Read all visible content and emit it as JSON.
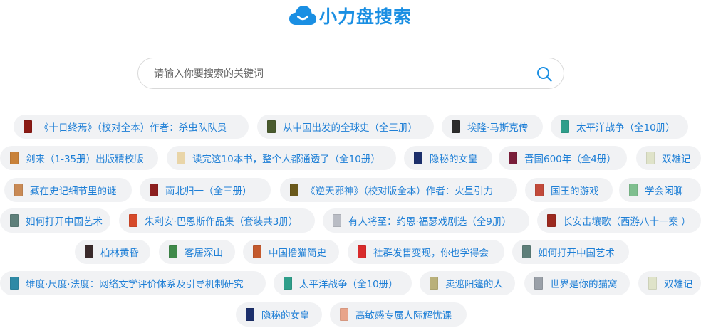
{
  "app": {
    "title": "小力盘搜索",
    "logo_icon": "cloud-icon",
    "accent": "#1a8fe3"
  },
  "search": {
    "placeholder": "请输入你要搜索的关键词",
    "value": "",
    "button_icon": "search-icon"
  },
  "hot_tags": [
    {
      "label": "《十日终焉》（校对全本）作者：杀虫队队员",
      "cover": "#8a1a14"
    },
    {
      "label": "从中国出发的全球史（全三册）",
      "cover": "#4a5b2e"
    },
    {
      "label": "埃隆·马斯克传",
      "cover": "#2c2c2c"
    },
    {
      "label": "太平洋战争（全10册）",
      "cover": "#2f9e8a"
    },
    {
      "label": "剑来（1-35册）出版精校版",
      "cover": "#c9823a"
    },
    {
      "label": "读完这10本书，整个人都通透了（全10册）",
      "cover": "#e9d5a8"
    },
    {
      "label": "隐秘的女皇",
      "cover": "#1c2f6b"
    },
    {
      "label": "晋国600年（全4册）",
      "cover": "#7a1e3a"
    },
    {
      "label": "双雄记",
      "cover": "#dfe3c9"
    },
    {
      "label": "藏在史记细节里的谜",
      "cover": "#c98a55"
    },
    {
      "label": "南北归一（全三册）",
      "cover": "#8c1f1f"
    },
    {
      "label": "《逆天邪神》（校对版全本）作者：火星引力",
      "cover": "#6b5a1c"
    },
    {
      "label": "国王的游戏",
      "cover": "#c24a3a"
    },
    {
      "label": "学会闲聊",
      "cover": "#7fbf8f"
    },
    {
      "label": "如何打开中国艺术",
      "cover": "#5e7f7a"
    },
    {
      "label": "朱利安·巴恩斯作品集（套装共3册）",
      "cover": "#d64a2a"
    },
    {
      "label": "有人将至：约恩·福瑟戏剧选（全9册）",
      "cover": "#b9bcc4"
    },
    {
      "label": "长安击壤歌（西游八十一案 ）",
      "cover": "#9c2a1f"
    },
    {
      "label": "柏林黄昏",
      "cover": "#3a2a2a"
    },
    {
      "label": "客居深山",
      "cover": "#3f8a4a"
    },
    {
      "label": "中国撸猫简史",
      "cover": "#c45a2e"
    },
    {
      "label": "社群发售变现，你也学得会",
      "cover": "#d92b2b"
    },
    {
      "label": "如何打开中国艺术",
      "cover": "#5e7f7a"
    },
    {
      "label": "维度·尺度·法度：网络文学评价体系及引导机制研究",
      "cover": "#2f8aa6"
    },
    {
      "label": "太平洋战争（全10册）",
      "cover": "#2f9e8a"
    },
    {
      "label": "卖遮阳篷的人",
      "cover": "#b9b07a"
    },
    {
      "label": "世界是你的猫窝",
      "cover": "#9aa0a8"
    },
    {
      "label": "双雄记",
      "cover": "#dfe3c9"
    },
    {
      "label": "隐秘的女皇",
      "cover": "#1c2f6b"
    },
    {
      "label": "高敏感专属人际解忧课",
      "cover": "#e8a48a"
    }
  ]
}
